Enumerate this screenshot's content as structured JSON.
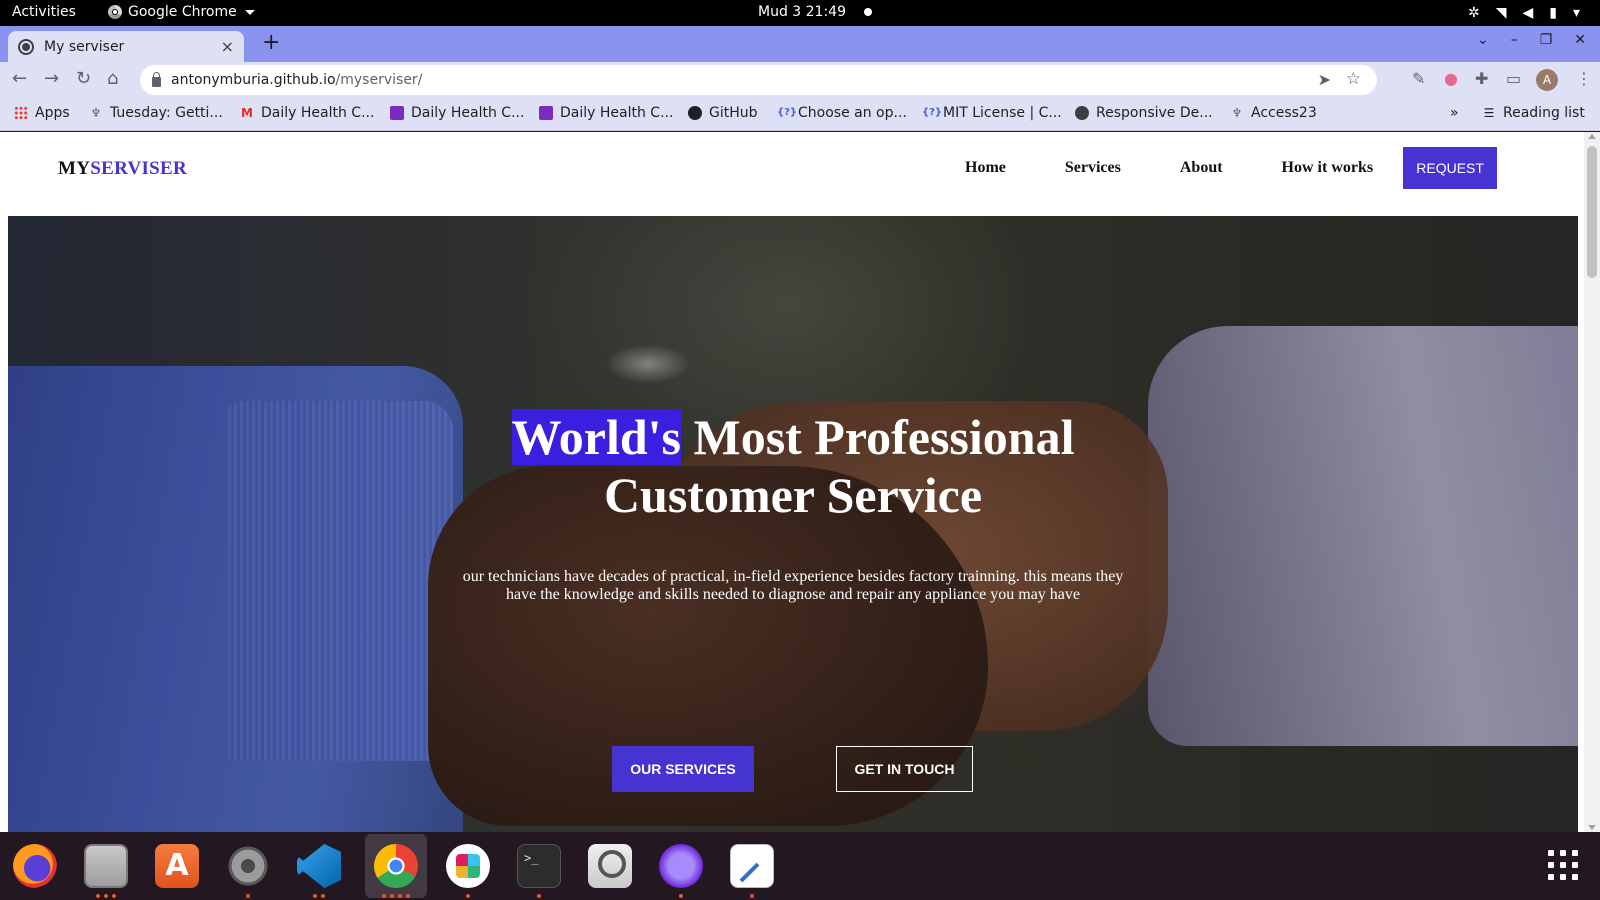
{
  "system_bar": {
    "activities": "Activities",
    "app_name": "Google Chrome",
    "datetime": "Mud 3  21:49"
  },
  "browser": {
    "tab_title": "My serviser",
    "tab_close": "×",
    "new_tab": "+",
    "url_host": "antonymburia.github.io",
    "url_path": "/myserviser/",
    "profile_initial": "A",
    "bookmarks": [
      {
        "label": "Apps",
        "icon": "apps-icon"
      },
      {
        "label": "Tuesday: Getti...",
        "icon": "pin-icon"
      },
      {
        "label": "Daily Health C...",
        "icon": "gmail-icon"
      },
      {
        "label": "Daily Health C...",
        "icon": "forms-icon"
      },
      {
        "label": "Daily Health C...",
        "icon": "forms-icon"
      },
      {
        "label": "GitHub",
        "icon": "github-icon"
      },
      {
        "label": "Choose an op...",
        "icon": "question-icon"
      },
      {
        "label": "MIT License | C...",
        "icon": "question-icon"
      },
      {
        "label": "Responsive De...",
        "icon": "globe-icon"
      },
      {
        "label": "Access23",
        "icon": "pin-icon"
      }
    ],
    "bookmarks_overflow": "»",
    "reading_list": "Reading list"
  },
  "site": {
    "logo_part1": "MY",
    "logo_part2": "SERVISER",
    "nav": [
      "Home",
      "Services",
      "About",
      "How it works"
    ],
    "request_button": "REQUEST",
    "hero": {
      "title_highlight": "World's",
      "title_rest_line1": " Most Professional",
      "title_line2": "Customer Service",
      "text": "our technicians have decades of practical, in-field experience besides factory trainning. this means they have the knowledge and skills needed to diagnose and repair any appliance you may have",
      "primary_button": "OUR SERVICES",
      "secondary_button": "GET IN TOUCH"
    }
  },
  "dock": {
    "apps": [
      "firefox",
      "files",
      "software-center",
      "settings",
      "vscode",
      "chrome",
      "slack",
      "terminal",
      "image-viewer",
      "web-app",
      "text-editor"
    ]
  },
  "colors": {
    "accent": "#4634d2",
    "tabstrip": "#8b93f0",
    "toolbar": "#dee1f6",
    "highlight": "#3a1fe0"
  }
}
